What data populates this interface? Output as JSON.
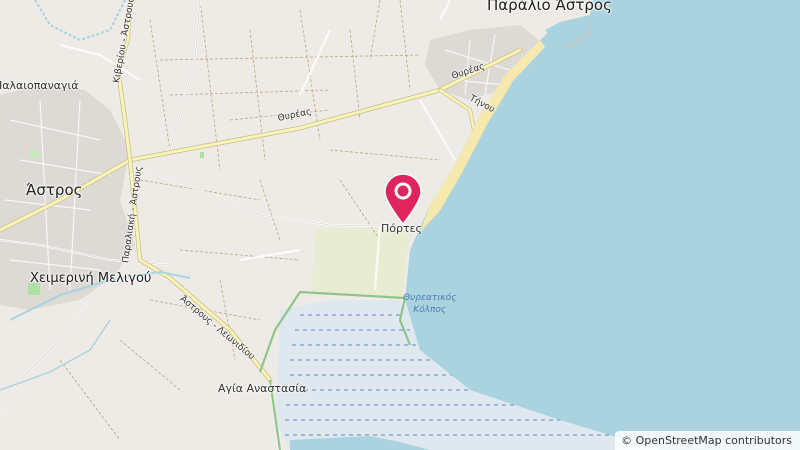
{
  "map": {
    "labels": {
      "astros": "Άστρος",
      "paralio_astros": "Παράλιο Άστρος",
      "portes": "Πόρτες",
      "cheimerini_meligou": "Χειμερινή Μελιγού",
      "agia_anastasia": "Αγία Αναστασία",
      "paleopanagia": "Παλαιοπαναγιά",
      "thyreatikos_kolpos_line1": "Θυρεατικός",
      "thyreatikos_kolpos_line2": "Κόλπος"
    },
    "roads": {
      "thyreas_1": "Θυρέας",
      "thyreas_2": "Θυρέας",
      "tinou": "Τήνου",
      "kiveriou_astrous": "Κιβερίου - Άστρους",
      "paralia_astrous": "Παραλιακή - Άστρους",
      "astrous_leonidiou": "Άστρους - Λεωνιδίου"
    },
    "marker": {
      "icon": "map-pin-icon",
      "color": "#e0245e"
    },
    "attribution": "© OpenStreetMap contributors"
  }
}
